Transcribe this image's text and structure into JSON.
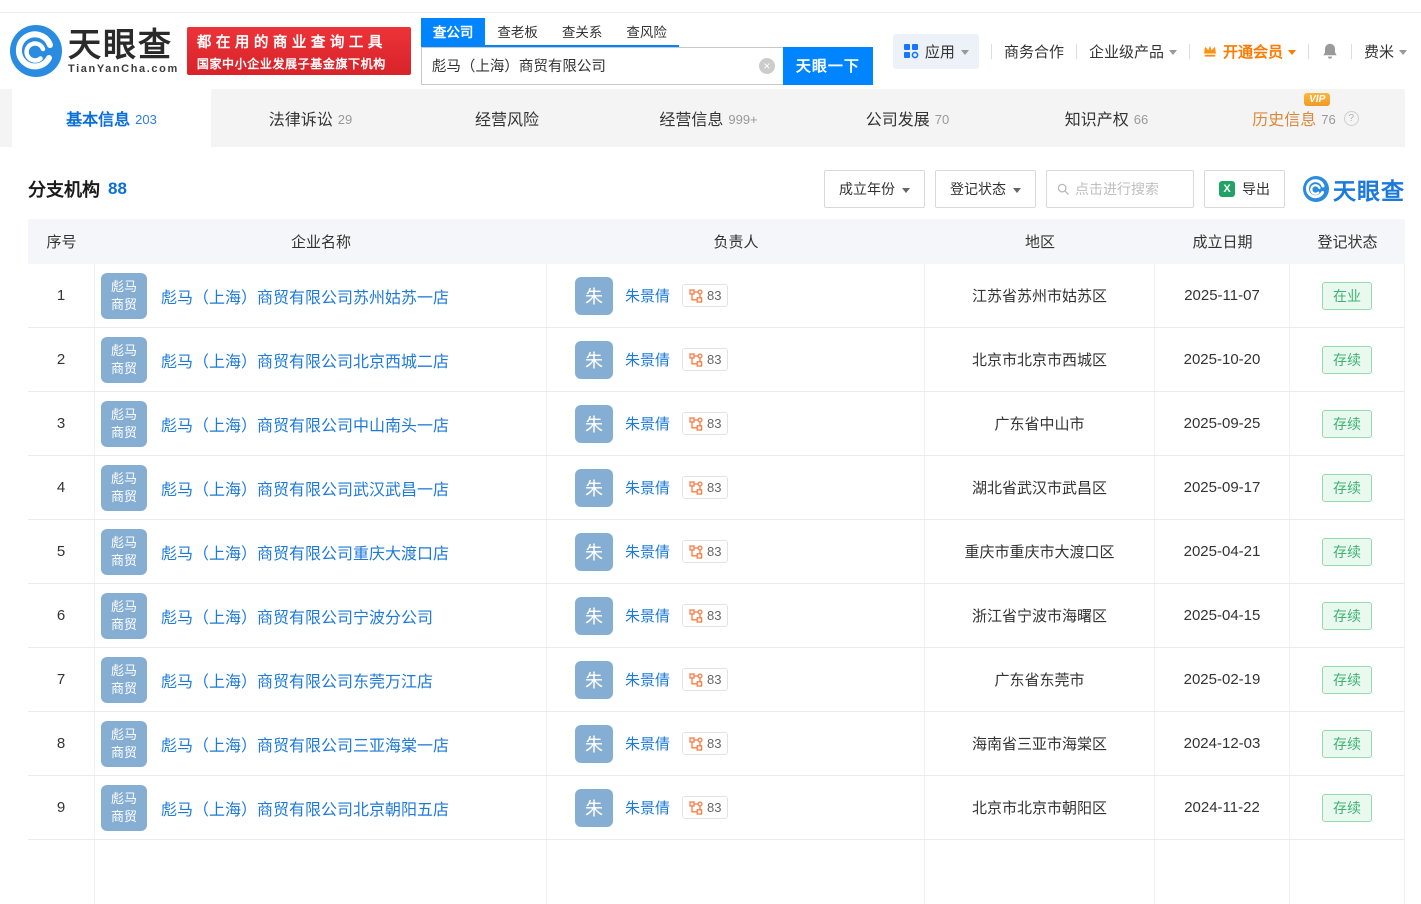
{
  "brand": {
    "name": "天眼查",
    "domain": "TianYanCha.com",
    "promo_line1": "都在用的商业查询工具",
    "promo_line2": "国家中小企业发展子基金旗下机构"
  },
  "search": {
    "tabs": [
      "查公司",
      "查老板",
      "查关系",
      "查风险"
    ],
    "active_tab": "查公司",
    "value": "彪马（上海）商贸有限公司",
    "button_label": "天眼一下",
    "clear_icon": "×"
  },
  "top_nav": {
    "apps_label": "应用",
    "business_label": "商务合作",
    "enterprise_label": "企业级产品",
    "vip_label": "开通会员",
    "user_label": "费米"
  },
  "page_tabs": [
    {
      "label": "基本信息",
      "count": "203"
    },
    {
      "label": "法律诉讼",
      "count": "29"
    },
    {
      "label": "经营风险",
      "count": ""
    },
    {
      "label": "经营信息",
      "count": "999+"
    },
    {
      "label": "公司发展",
      "count": "70"
    },
    {
      "label": "知识产权",
      "count": "66"
    },
    {
      "label": "历史信息",
      "count": "76",
      "vip_badge": "VIP",
      "help": "?"
    }
  ],
  "section": {
    "title": "分支机构",
    "count": "88"
  },
  "toolbar": {
    "year_filter_label": "成立年份",
    "status_filter_label": "登记状态",
    "search_placeholder": "点击进行搜索",
    "export_label": "导出",
    "excel_glyph": "X",
    "brand_label": "天眼查"
  },
  "table": {
    "headers": [
      "序号",
      "企业名称",
      "负责人",
      "地区",
      "成立日期",
      "登记状态"
    ],
    "rows": [
      {
        "no": "1",
        "logo1": "彪马",
        "logo2": "商贸",
        "company": "彪马（上海）商贸有限公司苏州姑苏一店",
        "avatar": "朱",
        "person": "朱景倩",
        "rel": "83",
        "region": "江苏省苏州市姑苏区",
        "date": "2025-11-07",
        "status": "在业"
      },
      {
        "no": "2",
        "logo1": "彪马",
        "logo2": "商贸",
        "company": "彪马（上海）商贸有限公司北京西城二店",
        "avatar": "朱",
        "person": "朱景倩",
        "rel": "83",
        "region": "北京市北京市西城区",
        "date": "2025-10-20",
        "status": "存续"
      },
      {
        "no": "3",
        "logo1": "彪马",
        "logo2": "商贸",
        "company": "彪马（上海）商贸有限公司中山南头一店",
        "avatar": "朱",
        "person": "朱景倩",
        "rel": "83",
        "region": "广东省中山市",
        "date": "2025-09-25",
        "status": "存续"
      },
      {
        "no": "4",
        "logo1": "彪马",
        "logo2": "商贸",
        "company": "彪马（上海）商贸有限公司武汉武昌一店",
        "avatar": "朱",
        "person": "朱景倩",
        "rel": "83",
        "region": "湖北省武汉市武昌区",
        "date": "2025-09-17",
        "status": "存续"
      },
      {
        "no": "5",
        "logo1": "彪马",
        "logo2": "商贸",
        "company": "彪马（上海）商贸有限公司重庆大渡口店",
        "avatar": "朱",
        "person": "朱景倩",
        "rel": "83",
        "region": "重庆市重庆市大渡口区",
        "date": "2025-04-21",
        "status": "存续"
      },
      {
        "no": "6",
        "logo1": "彪马",
        "logo2": "商贸",
        "company": "彪马（上海）商贸有限公司宁波分公司",
        "avatar": "朱",
        "person": "朱景倩",
        "rel": "83",
        "region": "浙江省宁波市海曙区",
        "date": "2025-04-15",
        "status": "存续"
      },
      {
        "no": "7",
        "logo1": "彪马",
        "logo2": "商贸",
        "company": "彪马（上海）商贸有限公司东莞万江店",
        "avatar": "朱",
        "person": "朱景倩",
        "rel": "83",
        "region": "广东省东莞市",
        "date": "2025-02-19",
        "status": "存续"
      },
      {
        "no": "8",
        "logo1": "彪马",
        "logo2": "商贸",
        "company": "彪马（上海）商贸有限公司三亚海棠一店",
        "avatar": "朱",
        "person": "朱景倩",
        "rel": "83",
        "region": "海南省三亚市海棠区",
        "date": "2024-12-03",
        "status": "存续"
      },
      {
        "no": "9",
        "logo1": "彪马",
        "logo2": "商贸",
        "company": "彪马（上海）商贸有限公司北京朝阳五店",
        "avatar": "朱",
        "person": "朱景倩",
        "rel": "83",
        "region": "北京市北京市朝阳区",
        "date": "2024-11-22",
        "status": "存续"
      }
    ]
  },
  "colors": {
    "brand_blue": "#0084ff",
    "link_blue": "#1e7ad9",
    "promo_red": "#d8232a",
    "vip_orange": "#ff7a00",
    "status_green": "#3cb371",
    "avatar_blue": "#86aed3",
    "rel_icon_orange": "#ff7a45"
  }
}
